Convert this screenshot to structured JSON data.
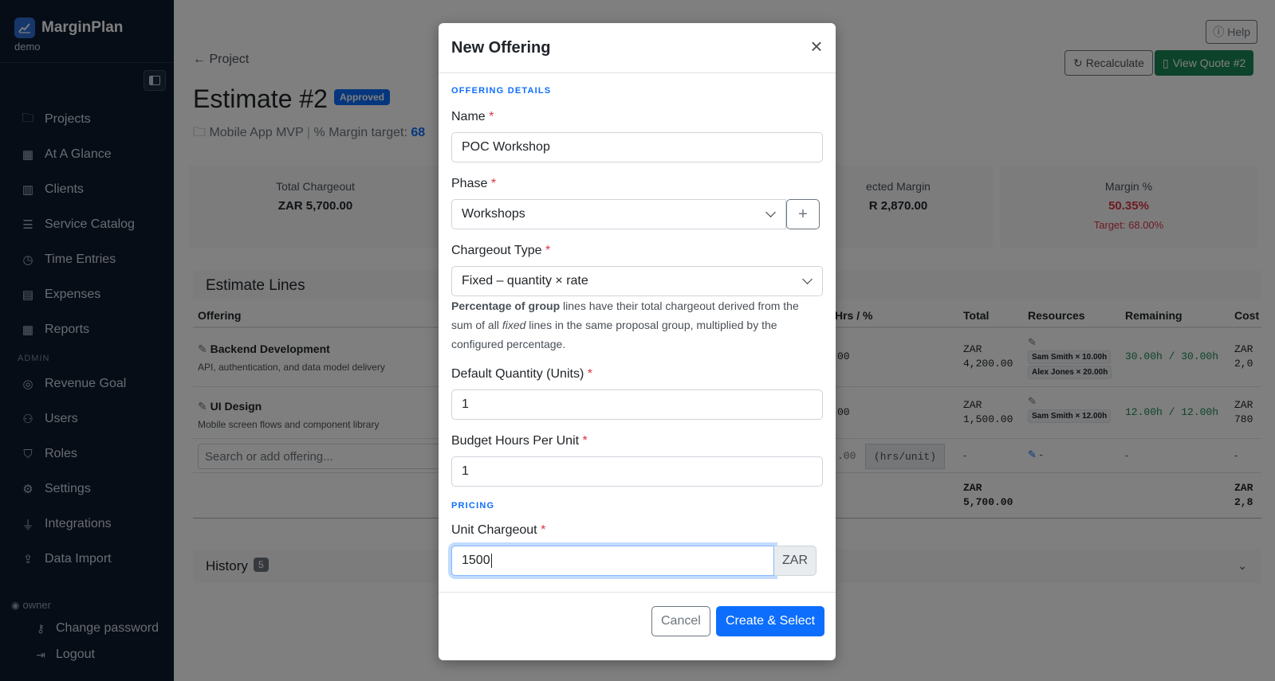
{
  "sidebar": {
    "brand": "MarginPlan",
    "tenant": "demo",
    "items": [
      {
        "label": "Projects",
        "icon": "folder-icon"
      },
      {
        "label": "At A Glance",
        "icon": "calendar-icon"
      },
      {
        "label": "Clients",
        "icon": "building-icon"
      },
      {
        "label": "Service Catalog",
        "icon": "list-icon"
      },
      {
        "label": "Time Entries",
        "icon": "clock-icon"
      },
      {
        "label": "Expenses",
        "icon": "receipt-icon"
      },
      {
        "label": "Reports",
        "icon": "table-icon"
      }
    ],
    "admin_label": "ADMIN",
    "admin_items": [
      {
        "label": "Revenue Goal",
        "icon": "target-icon"
      },
      {
        "label": "Users",
        "icon": "users-icon"
      },
      {
        "label": "Roles",
        "icon": "shield-icon"
      },
      {
        "label": "Settings",
        "icon": "gear-icon"
      },
      {
        "label": "Integrations",
        "icon": "plug-icon"
      },
      {
        "label": "Data Import",
        "icon": "upload-icon"
      }
    ],
    "user": "owner",
    "change_password": "Change password",
    "logout": "Logout"
  },
  "header": {
    "help": "Help",
    "recalculate": "Recalculate",
    "view_quote": "View Quote #2",
    "back": "Project",
    "title": "Estimate #2",
    "status": "Approved",
    "project": "Mobile App MVP",
    "margin_target_label": "% Margin target:",
    "margin_target_value": "68"
  },
  "stats": {
    "total_chargeout_label": "Total Chargeout",
    "total_chargeout_value": "ZAR 5,700.00",
    "projected_margin_label": "ected Margin",
    "projected_margin_value": "R 2,870.00",
    "margin_pct_label": "Margin %",
    "margin_pct_value": "50.35%",
    "margin_target": "Target: 68.00%"
  },
  "lines": {
    "title": "Estimate Lines",
    "columns": [
      "Offering",
      "Hrs / %",
      "Total",
      "Resources",
      "Remaining",
      "Cost"
    ],
    "rows": [
      {
        "name": "Backend Development",
        "desc": "API, authentication, and data model delivery",
        "hrs": "00",
        "total_cur": "ZAR",
        "total_val": "4,200.00",
        "res1": "Sam Smith × 10.00h",
        "res2": "Alex Jones × 20.00h",
        "remaining": "30.00h / 30.00h",
        "cost_cur": "ZAR",
        "cost_val": "2,0"
      },
      {
        "name": "UI Design",
        "desc": "Mobile screen flows and component library",
        "hrs": "00",
        "total_cur": "ZAR",
        "total_val": "1,500.00",
        "res1": "Sam Smith × 12.00h",
        "remaining": "12.00h / 12.00h",
        "cost_cur": "ZAR",
        "cost_val": "780"
      }
    ],
    "search_placeholder": "Search or add offering...",
    "new_hrs": ".00",
    "new_unit": "(hrs/unit)",
    "dash": "-",
    "sum_cur": "ZAR",
    "sum_total": "5,700.00",
    "sum_cost": "2,8"
  },
  "history": {
    "label": "History",
    "count": "5"
  },
  "modal": {
    "title": "New Offering",
    "section_details": "OFFERING DETAILS",
    "name_label": "Name",
    "name_value": "POC Workshop",
    "phase_label": "Phase",
    "phase_value": "Workshops",
    "chargeout_label": "Chargeout Type",
    "chargeout_value": "Fixed – quantity × rate",
    "help_bold": "Percentage of group",
    "help_a": " lines have their total chargeout derived from the sum of all ",
    "help_em": "fixed",
    "help_b": " lines in the same proposal group, multiplied by the configured percentage.",
    "qty_label": "Default Quantity (Units)",
    "qty_value": "1",
    "budget_label": "Budget Hours Per Unit",
    "budget_value": "1",
    "section_pricing": "PRICING",
    "unit_label": "Unit Chargeout",
    "unit_value": "1500",
    "unit_currency": "ZAR",
    "cancel": "Cancel",
    "create": "Create & Select",
    "required_mark": "*"
  },
  "colors": {
    "sidebar_bg": "#0d1b2e",
    "primary": "#0d6efd",
    "success": "#198754",
    "danger": "#dc3545"
  }
}
